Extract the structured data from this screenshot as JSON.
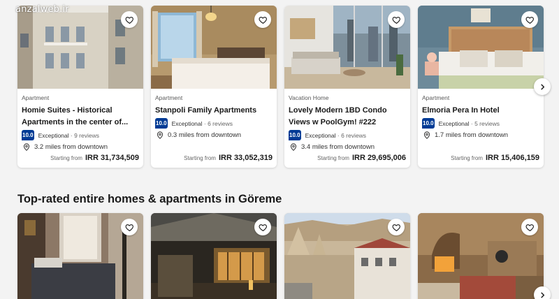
{
  "watermark": "anzalweb.ir",
  "top_row": [
    {
      "type": "Apartment",
      "name": "Homie Suites - Historical Apartments in the center of...",
      "score": "10.0",
      "rating_word": "Exceptional",
      "reviews": "· 9 reviews",
      "distance": "3.2 miles from downtown",
      "price_label": "Starting from",
      "price": "IRR 31,734,509"
    },
    {
      "type": "Apartment",
      "name": "Stanpoli Family Apartments",
      "score": "10.0",
      "rating_word": "Exceptional",
      "reviews": "· 6 reviews",
      "distance": "0.3 miles from downtown",
      "price_label": "Starting from",
      "price": "IRR 33,052,319"
    },
    {
      "type": "Vacation Home",
      "name": "Lovely Modern 1BD Condo Views w PoolGym! #222",
      "score": "10.0",
      "rating_word": "Exceptional",
      "reviews": "· 6 reviews",
      "distance": "3.4 miles from downtown",
      "price_label": "Starting from",
      "price": "IRR 29,695,006"
    },
    {
      "type": "Apartment",
      "name": "Elmoria Pera In Hotel",
      "score": "10.0",
      "rating_word": "Exceptional",
      "reviews": "· 5 reviews",
      "distance": "1.7 miles from downtown",
      "price_label": "Starting from",
      "price": "IRR 15,406,159"
    }
  ],
  "section2": {
    "title": "Top-rated entire homes & apartments in Göreme"
  },
  "colors": {
    "score_badge": "#003b95",
    "page_bg": "#f3f3f3"
  },
  "icons": {
    "favorite": "heart-icon",
    "location": "map-pin-icon",
    "next": "chevron-right-icon"
  }
}
